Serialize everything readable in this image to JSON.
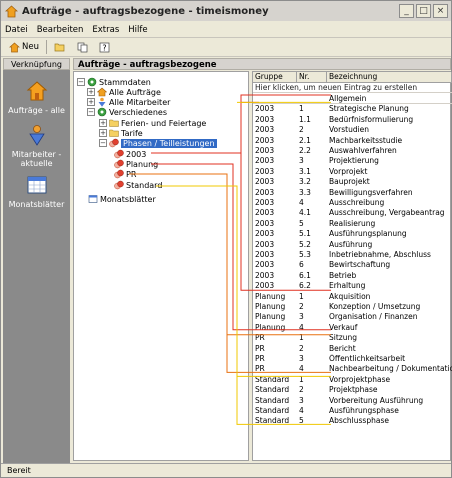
{
  "window": {
    "title": "Aufträge - auftragsbezogene - timeismoney"
  },
  "menu": [
    "Datei",
    "Bearbeiten",
    "Extras",
    "Hilfe"
  ],
  "toolbar": {
    "new_label": "Neu"
  },
  "left_panel": {
    "header": "Verknüpfung",
    "items": [
      {
        "label": "Aufträge - alle",
        "icon": "house-icon"
      },
      {
        "label": "Mitarbeiter - aktuelle",
        "icon": "person-icon"
      },
      {
        "label": "Monatsblätter",
        "icon": "calendar-icon"
      }
    ]
  },
  "main_header": "Aufträge - auftragsbezogene",
  "tree": [
    {
      "label": "Stammdaten",
      "level": 0,
      "expander": "-",
      "icon": "gear-icon"
    },
    {
      "label": "Alle Aufträge",
      "level": 1,
      "expander": "+",
      "icon": "house-icon"
    },
    {
      "label": "Alle Mitarbeiter",
      "level": 1,
      "expander": "+",
      "icon": "person-icon"
    },
    {
      "label": "Verschiedenes",
      "level": 1,
      "expander": "-",
      "icon": "gear-icon"
    },
    {
      "label": "Ferien- und Feiertage",
      "level": 2,
      "expander": "+",
      "icon": "folder-icon"
    },
    {
      "label": "Tarife",
      "level": 2,
      "expander": "+",
      "icon": "folder-icon"
    },
    {
      "label": "Phasen / Teilleistungen",
      "level": 2,
      "expander": "-",
      "icon": "phases-icon",
      "selected": true
    },
    {
      "label": "2003",
      "level": 3,
      "expander": "",
      "icon": "phases-icon"
    },
    {
      "label": "Planung",
      "level": 3,
      "expander": "",
      "icon": "phases-icon"
    },
    {
      "label": "PR",
      "level": 3,
      "expander": "",
      "icon": "phases-icon"
    },
    {
      "label": "Standard",
      "level": 3,
      "expander": "",
      "icon": "phases-icon"
    },
    {
      "label": "Monatsblätter",
      "level": 0,
      "expander": "",
      "icon": "calendar-icon"
    }
  ],
  "grid": {
    "columns": [
      "Gruppe",
      "Nr.",
      "Bezeichnung"
    ],
    "hint": "Hier klicken, um neuen Eintrag zu erstellen",
    "rows": [
      [
        "",
        "",
        "Allgemein"
      ],
      [
        "2003",
        "1",
        "Strategische Planung"
      ],
      [
        "2003",
        "1.1",
        "Bedürfnisformulierung"
      ],
      [
        "2003",
        "2",
        "Vorstudien"
      ],
      [
        "2003",
        "2.1",
        "Machbarkeitsstudie"
      ],
      [
        "2003",
        "2.2",
        "Auswahlverfahren"
      ],
      [
        "2003",
        "3",
        "Projektierung"
      ],
      [
        "2003",
        "3.1",
        "Vorprojekt"
      ],
      [
        "2003",
        "3.2",
        "Bauprojekt"
      ],
      [
        "2003",
        "3.3",
        "Bewilligungsverfahren"
      ],
      [
        "2003",
        "4",
        "Ausschreibung"
      ],
      [
        "2003",
        "4.1",
        "Ausschreibung, Vergabeantrag"
      ],
      [
        "2003",
        "5",
        "Realisierung"
      ],
      [
        "2003",
        "5.1",
        "Ausführungsplanung"
      ],
      [
        "2003",
        "5.2",
        "Ausführung"
      ],
      [
        "2003",
        "5.3",
        "Inbetriebnahme, Abschluss"
      ],
      [
        "2003",
        "6",
        "Bewirtschaftung"
      ],
      [
        "2003",
        "6.1",
        "Betrieb"
      ],
      [
        "2003",
        "6.2",
        "Erhaltung"
      ],
      [
        "Planung",
        "1",
        "Akquisition"
      ],
      [
        "Planung",
        "2",
        "Konzeption / Umsetzung"
      ],
      [
        "Planung",
        "3",
        "Organisation / Finanzen"
      ],
      [
        "Planung",
        "4",
        "Verkauf"
      ],
      [
        "PR",
        "1",
        "Sitzung"
      ],
      [
        "PR",
        "2",
        "Bericht"
      ],
      [
        "PR",
        "3",
        "Öffentlichkeitsarbeit"
      ],
      [
        "PR",
        "4",
        "Nachbearbeitung / Dokumentation"
      ],
      [
        "Standard",
        "1",
        "Vorprojektphase"
      ],
      [
        "Standard",
        "2",
        "Projektphase"
      ],
      [
        "Standard",
        "3",
        "Vorbereitung Ausführung"
      ],
      [
        "Standard",
        "4",
        "Ausführungsphase"
      ],
      [
        "Standard",
        "5",
        "Abschlussphase"
      ]
    ]
  },
  "status": "Bereit",
  "colors": {
    "red_annotation": "#e03020",
    "orange_annotation": "#e87010",
    "yellow_annotation": "#f0c800"
  }
}
